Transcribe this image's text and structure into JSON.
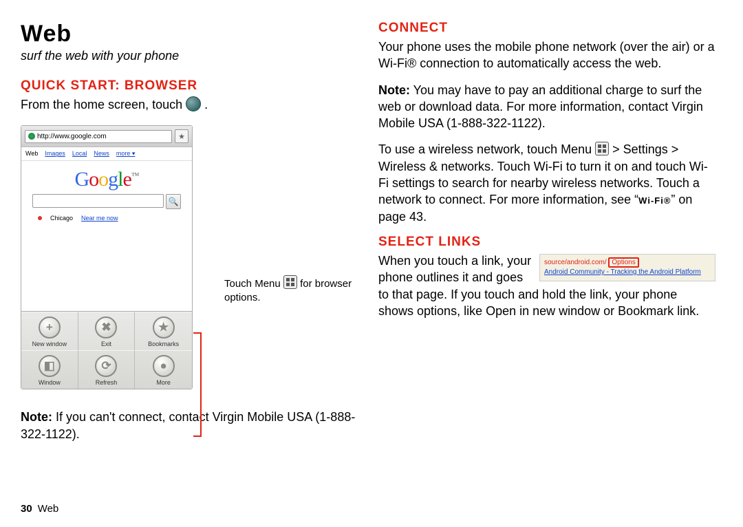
{
  "title": "Web",
  "subtitle": "surf the web with your phone",
  "left": {
    "h_quickstart": "Quick Start: Browser",
    "quickstart_line": "From the home screen, touch ",
    "note_label": "Note:",
    "note_body": " If you can't connect, contact Virgin Mobile USA (1-888-322-1122).",
    "callout_a": "Touch Menu ",
    "callout_b": " for browser options."
  },
  "phone": {
    "url": "http://www.google.com",
    "tabs": [
      "Web",
      "Images",
      "Local",
      "News",
      "more ▾"
    ],
    "location": "Chicago",
    "near_me": "Near me now",
    "menu": [
      {
        "sym": "+",
        "label": "New window"
      },
      {
        "sym": "✖",
        "label": "Exit"
      },
      {
        "sym": "★",
        "label": "Bookmarks"
      },
      {
        "sym": "◧",
        "label": "Window"
      },
      {
        "sym": "⟳",
        "label": "Refresh"
      },
      {
        "sym": "●",
        "label": "More"
      }
    ]
  },
  "right": {
    "h_connect": "Connect",
    "connect_p1": "Your phone uses the mobile phone network (over the air) or a Wi-Fi® connection to automatically access the web.",
    "connect_note_label": "Note:",
    "connect_note": " You may have to pay an additional charge to surf the web or download data. For more information, contact Virgin Mobile USA (1-888-322-1122).",
    "connect_p2a": "To use a wireless network, touch Menu ",
    "connect_p2b": " > Settings > Wireless & networks. Touch Wi-Fi to turn it on and touch Wi-Fi settings to search for nearby wireless networks. Touch a network to connect. For more information, see “",
    "connect_p2c": "Wi-Fi®",
    "connect_p2d": "” on page 43.",
    "h_select": "Select links",
    "select_p1": "When you touch a link, your phone outlines it and goes to that page. If you touch and hold the link, your phone shows options, like Open in new window or Bookmark link.",
    "demo_path": "source/android.com/",
    "demo_opt": "Options",
    "demo_line2": "Android Community - Tracking the Android Platform"
  },
  "footer": {
    "page": "30",
    "section": "Web"
  }
}
